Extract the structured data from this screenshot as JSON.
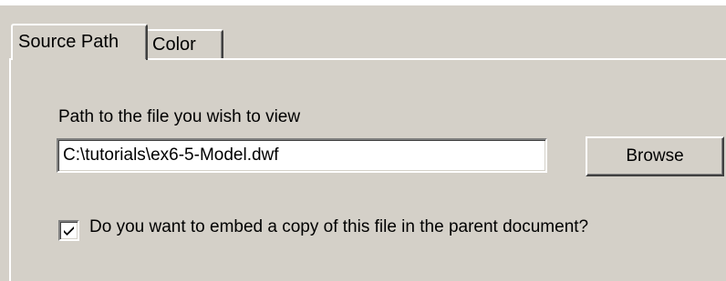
{
  "tabs": [
    {
      "label": "Source Path",
      "selected": true
    },
    {
      "label": "Color",
      "selected": false
    }
  ],
  "source_path": {
    "field_label": "Path to the file you wish to view",
    "path_value": "C:\\tutorials\\ex6-5-Model.dwf",
    "browse_label": "Browse",
    "embed_label": "Do you want to embed a copy of this file in the parent document?",
    "embed_checked": true
  },
  "colors": {
    "dialog_bg": "#d4d0c8",
    "text": "#000000"
  }
}
